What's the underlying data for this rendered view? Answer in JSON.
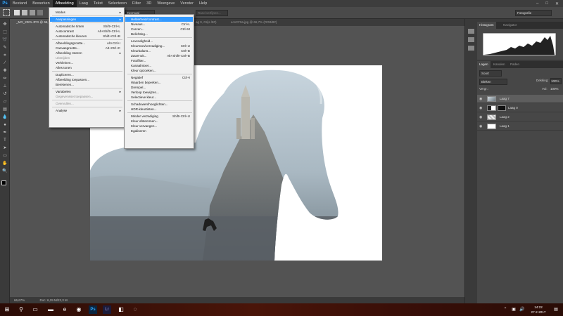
{
  "app": {
    "logo": "Ps"
  },
  "menubar": {
    "items": [
      "Bestand",
      "Bewerken",
      "Afbeelding",
      "Laag",
      "Tekst",
      "Selecteren",
      "Filter",
      "3D",
      "Weergave",
      "Venster",
      "Help"
    ],
    "active": "Afbeelding",
    "window_controls": [
      "–",
      "□",
      "✕"
    ]
  },
  "optionsbar": {
    "mode_label": "Normaal",
    "refine_label": "Rand verfijnen...",
    "workspace": "Fotografie"
  },
  "tabs": [
    {
      "label": "_MG_2001.JPG @ 66,7% (Laag 7, RGB/8#)"
    },
    {
      "label": "ag 0, Grijs /8#)"
    },
    {
      "label": "ecsCF9a.jpg @ 66,7% (RGB/8#)"
    }
  ],
  "status": {
    "zoom": "66,67%",
    "doc": "Doc: 6,29 M/22,3 M"
  },
  "afbeelding_menu": [
    {
      "label": "Modus",
      "shortcut": "",
      "submenu": true
    },
    {
      "sep": true
    },
    {
      "label": "Aanpassingen",
      "shortcut": "",
      "submenu": true,
      "highlight": true
    },
    {
      "sep": true
    },
    {
      "label": "Automatische tinten",
      "shortcut": "Shift+Ctrl+L"
    },
    {
      "label": "Autocontrast",
      "shortcut": "Alt+Shift+Ctrl+L"
    },
    {
      "label": "Automatische kleuren",
      "shortcut": "Shift+Ctrl+B"
    },
    {
      "sep": true
    },
    {
      "label": "Afbeeldingsgrootte...",
      "shortcut": "Alt+Ctrl+I"
    },
    {
      "label": "Canvasgrootte...",
      "shortcut": "Alt+Ctrl+C"
    },
    {
      "label": "Afbeelding roteren",
      "shortcut": "",
      "submenu": true
    },
    {
      "label": "Uitsnijden",
      "shortcut": "",
      "disabled": true
    },
    {
      "label": "Verkleinen...",
      "shortcut": ""
    },
    {
      "label": "Alles tonen",
      "shortcut": ""
    },
    {
      "sep": true
    },
    {
      "label": "Dupliceren...",
      "shortcut": ""
    },
    {
      "label": "Afbeelding toepassen...",
      "shortcut": ""
    },
    {
      "label": "Berekenen...",
      "shortcut": ""
    },
    {
      "sep": true
    },
    {
      "label": "Variabelen",
      "shortcut": "",
      "submenu": true
    },
    {
      "label": "Gegevensset toepassen...",
      "shortcut": "",
      "disabled": true
    },
    {
      "sep": true
    },
    {
      "label": "Overvullen...",
      "shortcut": "",
      "disabled": true
    },
    {
      "sep": true
    },
    {
      "label": "Analyse",
      "shortcut": "",
      "submenu": true
    }
  ],
  "aanpassingen_menu": [
    {
      "label": "Helderheid/contrast...",
      "shortcut": "",
      "highlight": true
    },
    {
      "label": "Niveaus...",
      "shortcut": "Ctrl+L"
    },
    {
      "label": "Curven...",
      "shortcut": "Ctrl+M"
    },
    {
      "label": "Belichting...",
      "shortcut": ""
    },
    {
      "sep": true
    },
    {
      "label": "Levendigheid...",
      "shortcut": ""
    },
    {
      "label": "Kleurtoon/verzadiging...",
      "shortcut": "Ctrl+U"
    },
    {
      "label": "Kleurbalans...",
      "shortcut": "Ctrl+B"
    },
    {
      "label": "Zwart-wit...",
      "shortcut": "Alt+Shift+Ctrl+B"
    },
    {
      "label": "Fotofilter...",
      "shortcut": ""
    },
    {
      "label": "Kanaalmixer...",
      "shortcut": ""
    },
    {
      "label": "Kleur opzoeken...",
      "shortcut": ""
    },
    {
      "sep": true
    },
    {
      "label": "Negatief",
      "shortcut": "Ctrl+I"
    },
    {
      "label": "Waarden beperken...",
      "shortcut": ""
    },
    {
      "label": "Drempel...",
      "shortcut": ""
    },
    {
      "label": "Verloop toewijzen...",
      "shortcut": ""
    },
    {
      "label": "Selectieve kleur...",
      "shortcut": ""
    },
    {
      "sep": true
    },
    {
      "label": "Schaduwen/hooglichten...",
      "shortcut": ""
    },
    {
      "label": "HDR-kleurtinten...",
      "shortcut": ""
    },
    {
      "sep": true
    },
    {
      "label": "Minder verzadiging",
      "shortcut": "Shift+Ctrl+U"
    },
    {
      "label": "Kleur afstemmen...",
      "shortcut": ""
    },
    {
      "label": "Kleur vervangen...",
      "shortcut": ""
    },
    {
      "label": "Egaliseren",
      "shortcut": ""
    }
  ],
  "panels": {
    "top_tabs": [
      "Histogram",
      "Navigator"
    ],
    "layer_tabs": [
      "Lagen",
      "Kanalen",
      "Paden"
    ],
    "kind_label": "Soort",
    "blend_mode": "Bleken",
    "opacity_label": "Dekking:",
    "opacity": "100%",
    "lock_label": "Vergr.:",
    "fill_label": "Vul:",
    "fill": "100%",
    "layers": [
      {
        "name": "Laag 7",
        "selected": true
      },
      {
        "name": "Laag 0",
        "selected": false
      },
      {
        "name": "Laag 2",
        "selected": false
      },
      {
        "name": "Laag 1",
        "selected": false
      }
    ]
  },
  "taskbar": {
    "time": "14:22",
    "date": "27-2-2017"
  }
}
